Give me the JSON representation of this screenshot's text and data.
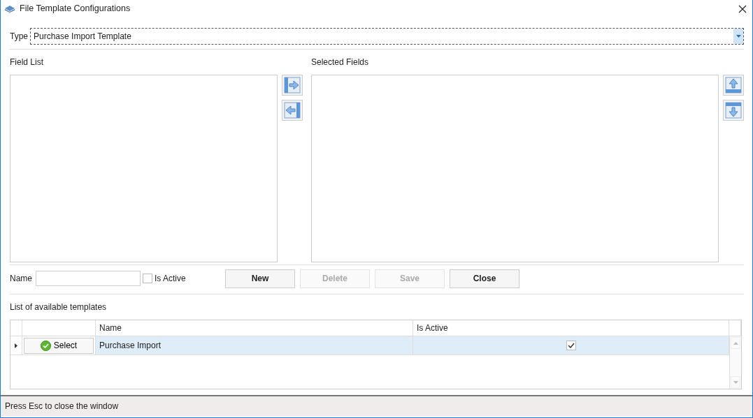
{
  "window": {
    "title": "File Template Configurations"
  },
  "type_field": {
    "label": "Type",
    "value": "Purchase Import Template"
  },
  "field_list": {
    "label": "Field List"
  },
  "selected_fields": {
    "label": "Selected Fields"
  },
  "name_field": {
    "label": "Name"
  },
  "is_active": {
    "label": "Is Active",
    "checked": false
  },
  "buttons": [
    {
      "label": "New",
      "disabled": false
    },
    {
      "label": "Delete",
      "disabled": true
    },
    {
      "label": "Save",
      "disabled": true
    },
    {
      "label": "Close",
      "disabled": false
    }
  ],
  "templates": {
    "label": "List of available templates",
    "columns": [
      "Name",
      "Is Active"
    ],
    "rows": [
      {
        "action": "Select",
        "name": "Purchase Import",
        "is_active": true,
        "selected": true
      }
    ]
  },
  "status_bar": "Press Esc to close the window"
}
